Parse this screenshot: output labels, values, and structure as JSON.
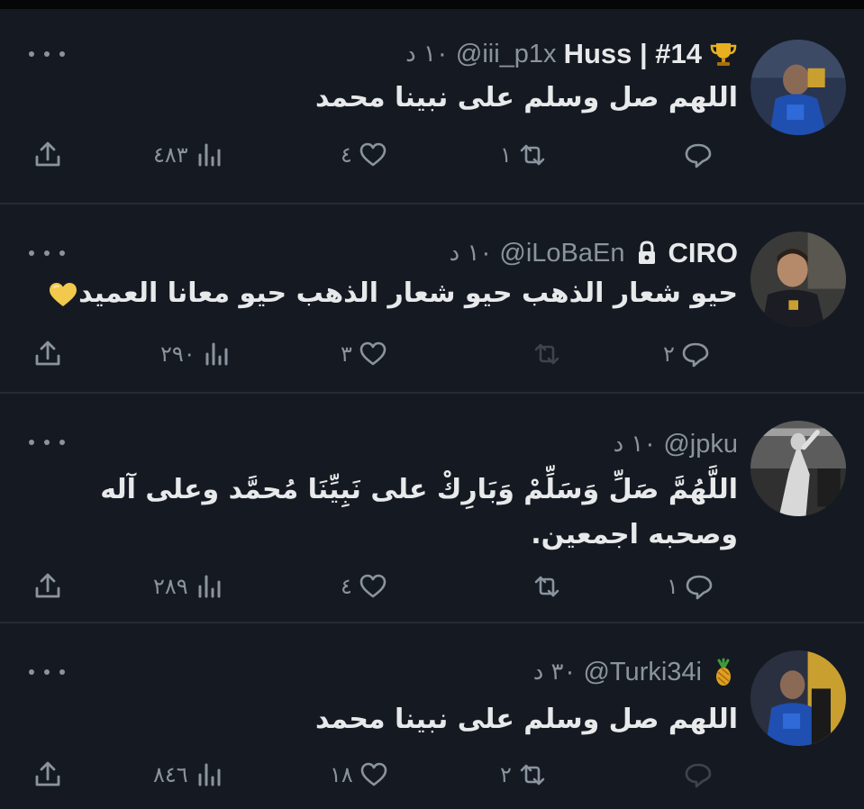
{
  "tweets": [
    {
      "display_name": "Huss | #14",
      "handle": "@iii_p1x",
      "time": "١٠ د",
      "badge": "trophy-emoji",
      "text_lines": [
        "اللهم صل وسلم على نبينا محمد"
      ],
      "views": "٤٨٣",
      "likes": "٤",
      "retweets": "١",
      "replies": ""
    },
    {
      "display_name": "CIRO",
      "handle": "@iLoBaEn",
      "time": "١٠ د",
      "badge": "lock-icon",
      "text_lines": [
        "حيو شعار الذهب حيو شعار الذهب حيو معانا العميد"
      ],
      "trailing_emoji": "yellow-heart-emoji",
      "views": "٢٩٠",
      "likes": "٣",
      "retweets": "",
      "replies": "٢"
    },
    {
      "display_name": "",
      "handle": "@jpku",
      "time": "١٠ د",
      "badge": "",
      "text_lines": [
        "اللَّهُمَّ صَلِّ وَسَلِّمْ وَبَارِكْ على نَبِيِّنَا مُحمَّد وعلى آله",
        "وصحبه اجمعين."
      ],
      "views": "٢٨٩",
      "likes": "٤",
      "retweets": "",
      "replies": "١"
    },
    {
      "display_name": "",
      "handle": "@Turki34i",
      "time": "٣٠ د",
      "badge": "pineapple-emoji",
      "text_lines": [
        "اللهم صل وسلم على نبينا محمد"
      ],
      "views": "٨٤٦",
      "likes": "١٨",
      "retweets": "٢",
      "replies": ""
    }
  ],
  "colors": {
    "background": "#151a22",
    "divider": "#242b35",
    "text": "#e7e9ea",
    "muted": "#8b949e",
    "trophy": "#e8b020",
    "heart_emoji": "#f2c94c"
  }
}
